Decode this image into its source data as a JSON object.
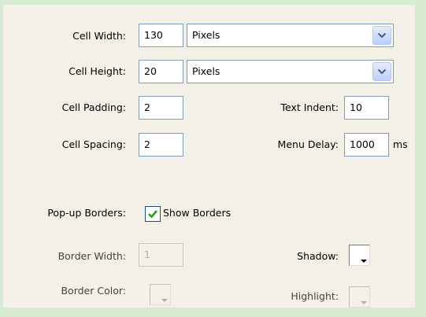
{
  "cell_width": {
    "label": "Cell Width:",
    "value": "130",
    "unit": "Pixels"
  },
  "cell_height": {
    "label": "Cell Height:",
    "value": "20",
    "unit": "Pixels"
  },
  "cell_padding": {
    "label": "Cell Padding:",
    "value": "2"
  },
  "text_indent": {
    "label": "Text Indent:",
    "value": "10"
  },
  "cell_spacing": {
    "label": "Cell Spacing:",
    "value": "2"
  },
  "menu_delay": {
    "label": "Menu Delay:",
    "value": "1000",
    "unit": "ms"
  },
  "popup_borders": {
    "label": "Pop-up Borders:",
    "checkbox_label": "Show Borders",
    "checked": true
  },
  "border_width": {
    "label": "Border Width:",
    "value": "1",
    "disabled": true
  },
  "shadow": {
    "label": "Shadow:",
    "color": "#ffffff"
  },
  "border_color": {
    "label": "Border Color:",
    "disabled": true
  },
  "highlight": {
    "label": "Highlight:",
    "disabled": true
  },
  "icons": [
    "chevron-down-icon",
    "checkmark-icon",
    "color-dropdown-triangle-icon"
  ],
  "colors": {
    "panel": "#f2f0e7",
    "outer": "#d6ebd2",
    "input_border": "#7f9db9",
    "check": "#21a121"
  }
}
